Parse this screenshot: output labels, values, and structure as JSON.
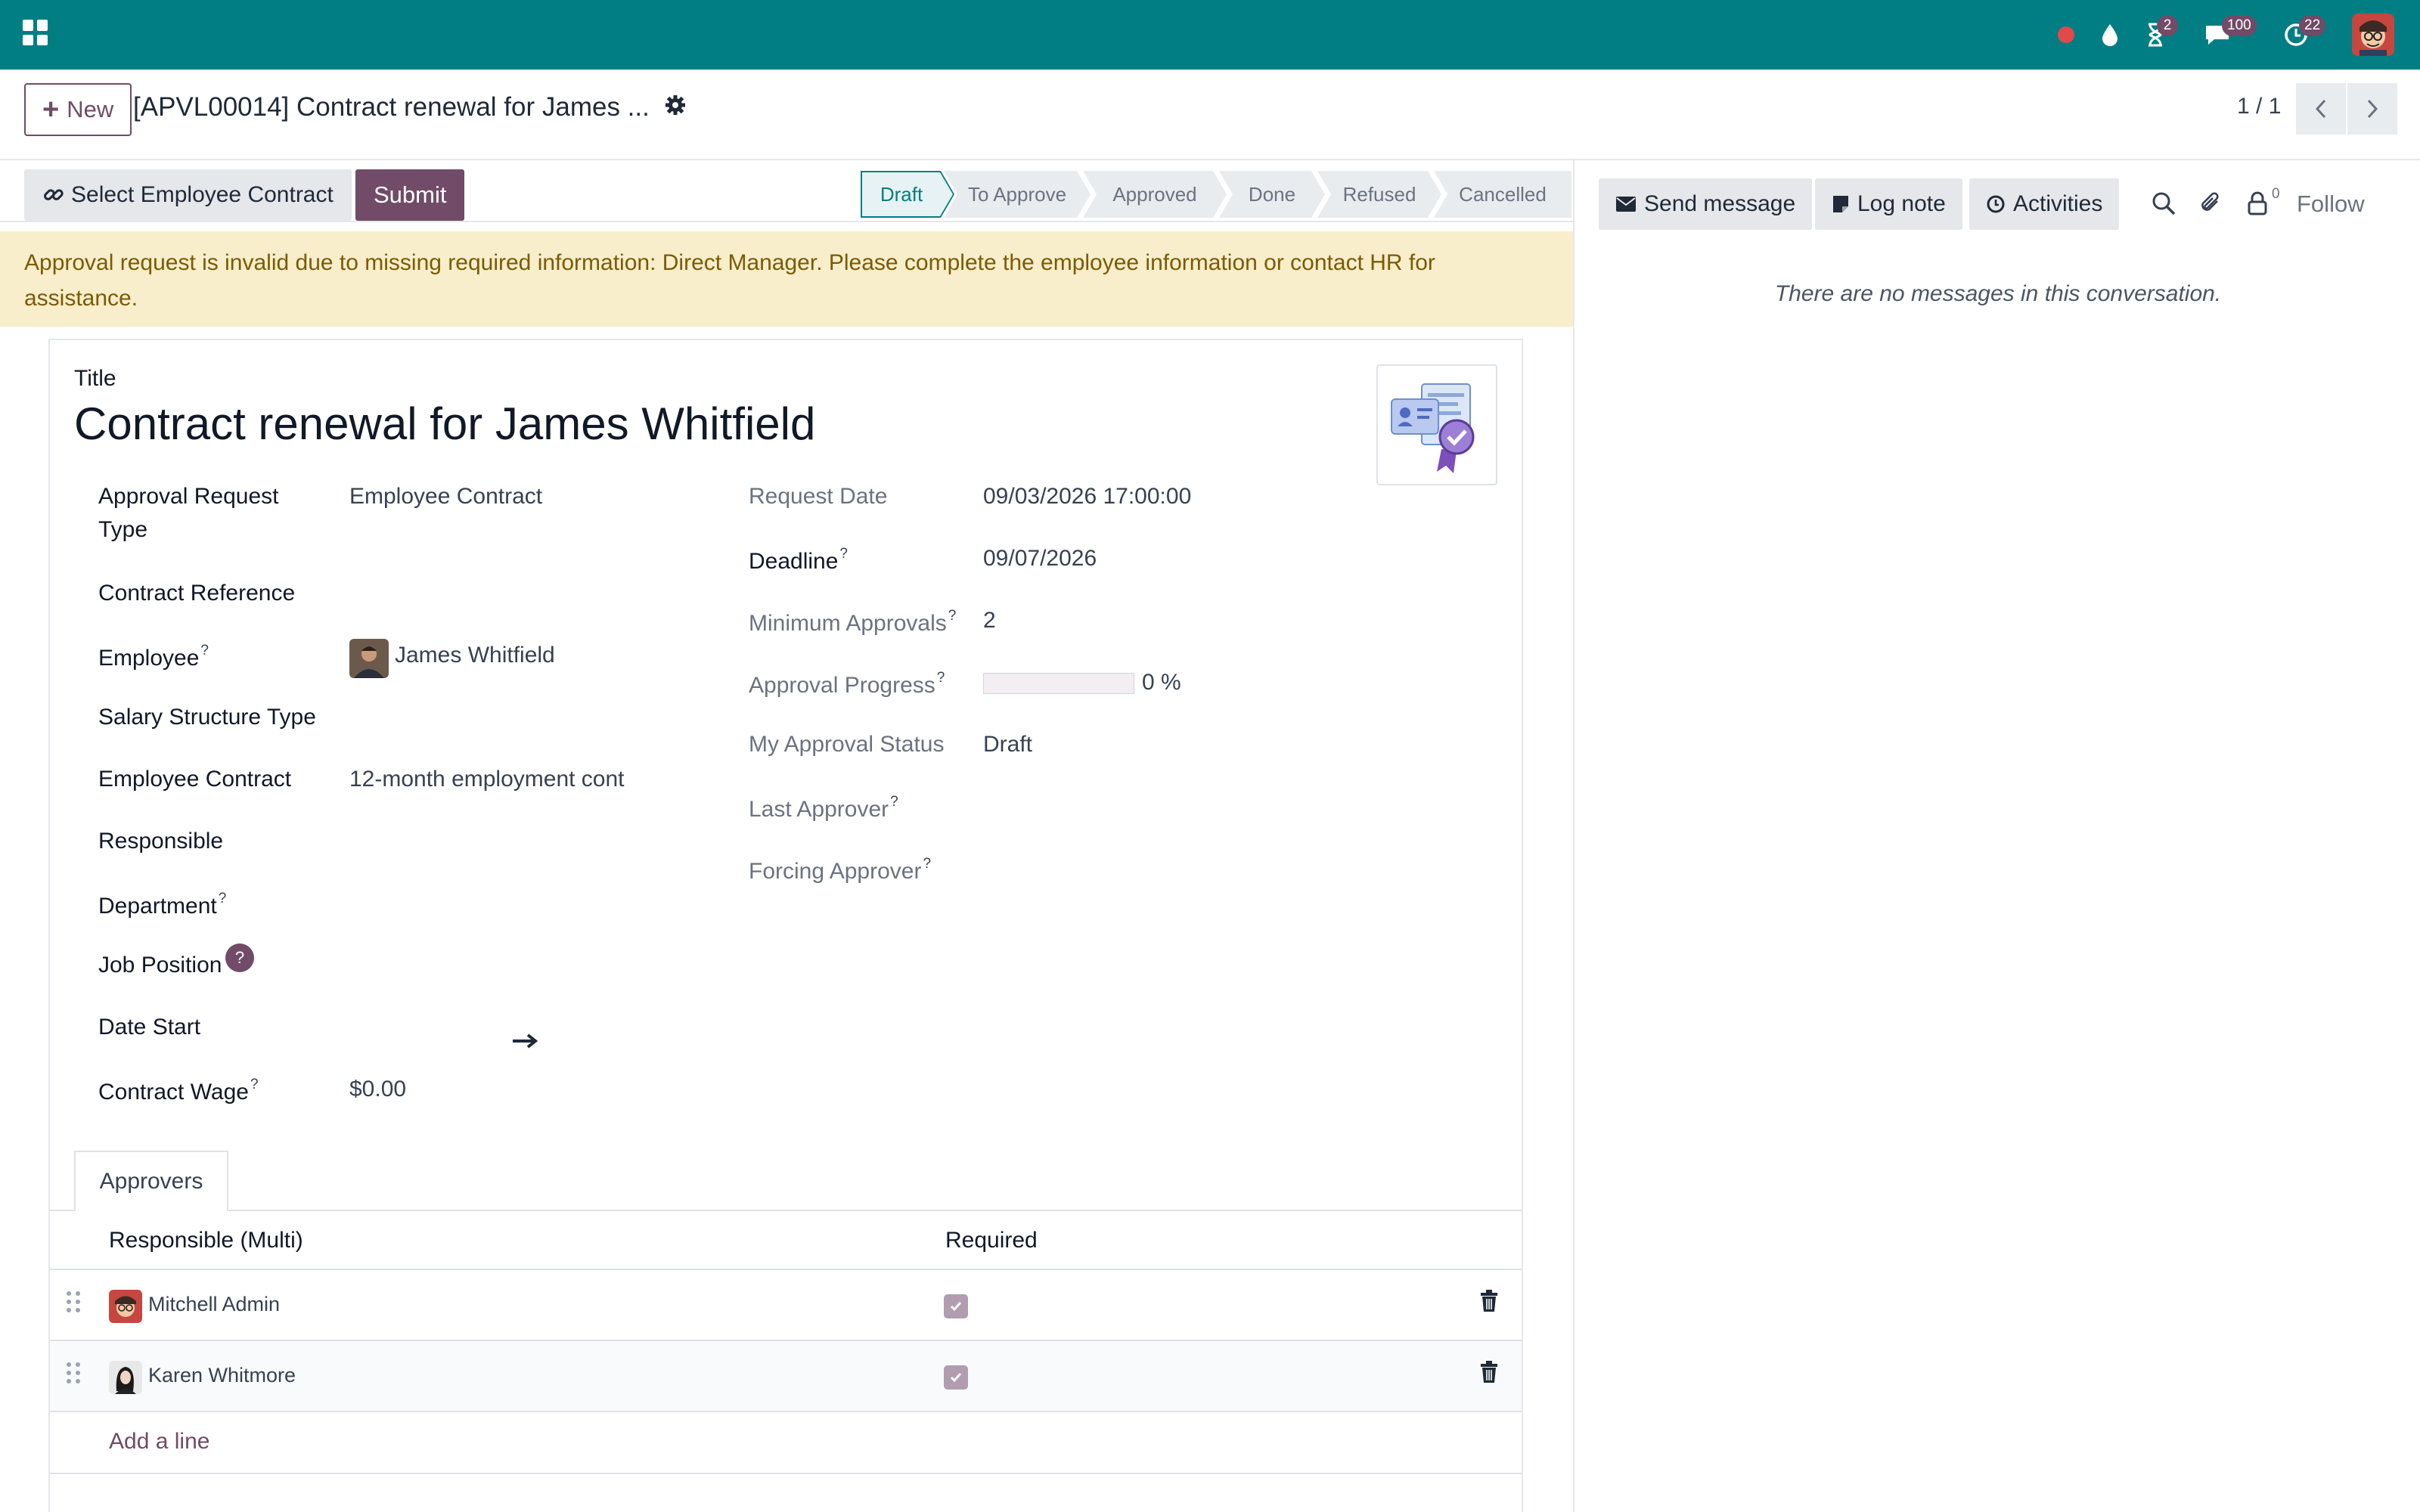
{
  "navbar": {
    "badges": {
      "activities": "2",
      "messages": "100",
      "calls": "22"
    },
    "colors": {
      "bar": "#017e84",
      "badge": "#714b67",
      "record_dot": "#e04a4a"
    }
  },
  "control": {
    "new_label": "New",
    "record_title": "[APVL00014] Contract renewal for James ...",
    "pager": "1 / 1"
  },
  "statusbar": {
    "select_contract_label": "Select Employee Contract",
    "submit_label": "Submit",
    "stages": [
      "Draft",
      "To Approve",
      "Approved",
      "Done",
      "Refused",
      "Cancelled"
    ],
    "active_stage": "Draft"
  },
  "alert": {
    "text": "Approval request is invalid due to missing required information: Direct Manager. Please complete the employee information or contact HR for assistance."
  },
  "form": {
    "title_label": "Title",
    "title": "Contract renewal for James Whitfield",
    "left": {
      "approval_request_type_label": "Approval Request",
      "approval_request_type_label2": "Type",
      "approval_request_type": "Employee Contract",
      "contract_reference_label": "Contract Reference",
      "employee_label": "Employee",
      "employee": "James Whitfield",
      "salary_structure_type_label": "Salary Structure Type",
      "employee_contract_label": "Employee Contract",
      "employee_contract": "12-month employment cont",
      "responsible_label": "Responsible",
      "department_label": "Department",
      "job_position_label": "Job Position",
      "date_start_label": "Date Start",
      "contract_wage_label": "Contract Wage",
      "contract_wage": "$0.00"
    },
    "right": {
      "request_date_label": "Request Date",
      "request_date": "09/03/2026 17:00:00",
      "deadline_label": "Deadline",
      "deadline": "09/07/2026",
      "minimum_approvals_label": "Minimum Approvals",
      "minimum_approvals": "2",
      "approval_progress_label": "Approval Progress",
      "approval_progress_percent": 0,
      "approval_progress_text": "0 %",
      "my_approval_status_label": "My Approval Status",
      "my_approval_status": "Draft",
      "last_approver_label": "Last Approver",
      "forcing_approver_label": "Forcing Approver"
    },
    "help_marker": "?"
  },
  "approvers": {
    "tab_label": "Approvers",
    "columns": [
      "Responsible (Multi)",
      "Required"
    ],
    "rows": [
      {
        "name": "Mitchell Admin",
        "required": true
      },
      {
        "name": "Karen Whitmore",
        "required": true
      }
    ],
    "add_line": "Add a line"
  },
  "chatter": {
    "send_message": "Send message",
    "log_note": "Log note",
    "activities": "Activities",
    "followers_count": "0",
    "follow": "Follow",
    "empty_text": "There are no messages in this conversation."
  }
}
